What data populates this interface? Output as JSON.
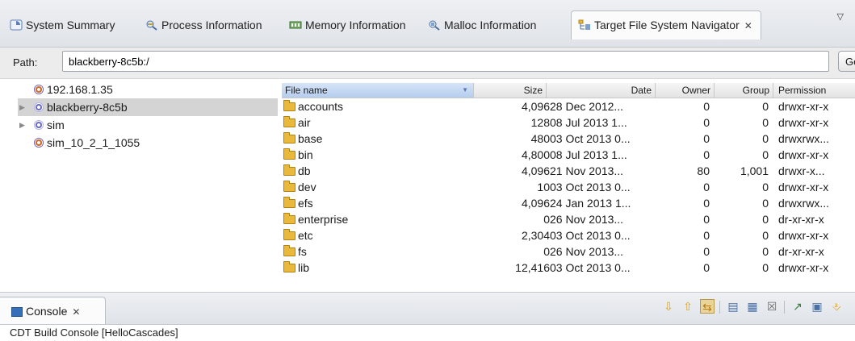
{
  "tabs": [
    {
      "label": "System Summary",
      "icon": "system-summary-icon"
    },
    {
      "label": "Process Information",
      "icon": "process-info-icon"
    },
    {
      "label": "Memory Information",
      "icon": "memory-info-icon"
    },
    {
      "label": "Malloc Information",
      "icon": "malloc-info-icon"
    },
    {
      "label": "Target File System Navigator",
      "icon": "file-system-icon",
      "active": true,
      "close_glyph": "✕"
    }
  ],
  "view_menu_glyph": "▽",
  "path": {
    "label": "Path:",
    "value": "blackberry-8c5b:/",
    "button_label": "Go"
  },
  "tree": [
    {
      "label": "192.168.1.35",
      "type": "remote",
      "expandable": false
    },
    {
      "label": "blackberry-8c5b",
      "type": "local",
      "expandable": true,
      "selected": true
    },
    {
      "label": "sim",
      "type": "local",
      "expandable": true
    },
    {
      "label": "sim_10_2_1_1055",
      "type": "remote",
      "expandable": false
    }
  ],
  "table": {
    "headers": {
      "name": "File name",
      "size": "Size",
      "date": "Date",
      "owner": "Owner",
      "group": "Group",
      "permission": "Permission"
    },
    "rows": [
      {
        "name": "accounts",
        "size": "4,096",
        "date": "28 Dec 2012...",
        "owner": "0",
        "group": "0",
        "permission": "drwxr-xr-x"
      },
      {
        "name": "air",
        "size": "128",
        "date": "08 Jul 2013 1...",
        "owner": "0",
        "group": "0",
        "permission": "drwxr-xr-x"
      },
      {
        "name": "base",
        "size": "480",
        "date": "03 Oct 2013 0...",
        "owner": "0",
        "group": "0",
        "permission": "drwxrwx..."
      },
      {
        "name": "bin",
        "size": "4,800",
        "date": "08 Jul 2013 1...",
        "owner": "0",
        "group": "0",
        "permission": "drwxr-xr-x"
      },
      {
        "name": "db",
        "size": "4,096",
        "date": "21 Nov 2013...",
        "owner": "80",
        "group": "1,001",
        "permission": "drwxr-x..."
      },
      {
        "name": "dev",
        "size": "10",
        "date": "03 Oct 2013 0...",
        "owner": "0",
        "group": "0",
        "permission": "drwxr-xr-x"
      },
      {
        "name": "efs",
        "size": "4,096",
        "date": "24 Jan 2013 1...",
        "owner": "0",
        "group": "0",
        "permission": "drwxrwx..."
      },
      {
        "name": "enterprise",
        "size": "0",
        "date": "26 Nov 2013...",
        "owner": "0",
        "group": "0",
        "permission": "dr-xr-xr-x"
      },
      {
        "name": "etc",
        "size": "2,304",
        "date": "03 Oct 2013 0...",
        "owner": "0",
        "group": "0",
        "permission": "drwxr-xr-x"
      },
      {
        "name": "fs",
        "size": "0",
        "date": "26 Nov 2013...",
        "owner": "0",
        "group": "0",
        "permission": "dr-xr-xr-x"
      },
      {
        "name": "lib",
        "size": "12,416",
        "date": "03 Oct 2013 0...",
        "owner": "0",
        "group": "0",
        "permission": "drwxr-xr-x"
      }
    ]
  },
  "console": {
    "tab_label": "Console",
    "close_glyph": "✕",
    "name": "CDT Build Console [HelloCascades]",
    "toolbar": [
      {
        "icon": "scroll-down-icon",
        "glyph": "⇩",
        "color": "#d8a020"
      },
      {
        "icon": "scroll-up-icon",
        "glyph": "⇧",
        "color": "#d8a020"
      },
      {
        "icon": "scroll-lock-icon",
        "glyph": "⇆",
        "color": "#b87a10",
        "pressed": true
      },
      {
        "icon": "clear-console-icon",
        "glyph": "▤",
        "color": "#4a6fa5"
      },
      {
        "icon": "word-wrap-icon",
        "glyph": "▦",
        "color": "#4a6fa5"
      },
      {
        "icon": "remove-launch-icon",
        "glyph": "☒",
        "color": "#6a6a6a"
      },
      {
        "icon": "pin-console-icon",
        "glyph": "↗",
        "color": "#3a7a3a"
      },
      {
        "icon": "display-console-icon",
        "glyph": "▣",
        "color": "#4a6fa5"
      },
      {
        "icon": "open-console-icon",
        "glyph": "⎀",
        "color": "#d8a020"
      }
    ]
  }
}
